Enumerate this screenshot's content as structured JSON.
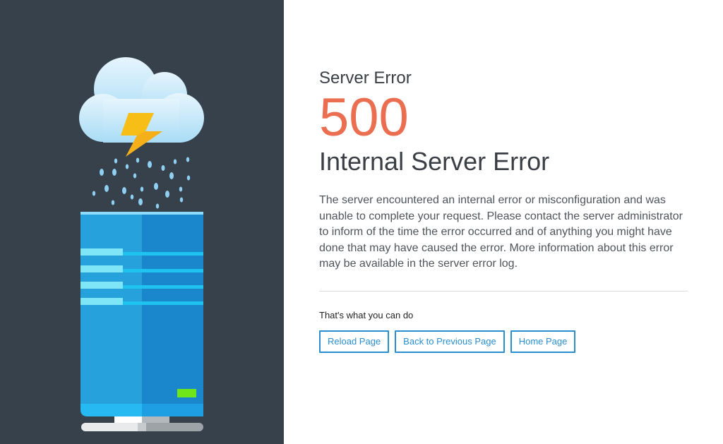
{
  "page": {
    "kicker": "Server Error",
    "code": "500",
    "title": "Internal Server Error",
    "message": "The server encountered an internal error or misconfiguration and was unable to complete your request. Please contact the server administrator to inform of the time the error occurred and of anything you might have done that may have caused the error. More information about this error may be available in the server error log.",
    "actions_label": "That's what you can do"
  },
  "buttons": {
    "reload": "Reload Page",
    "back": "Back to Previous Page",
    "home": "Home Page"
  },
  "illustration": {
    "icons": [
      "cloud-icon",
      "lightning-icon",
      "rain-icon",
      "server-icon"
    ]
  },
  "colors": {
    "panel": "#36414c",
    "accent": "#2a8fcf",
    "error_code": "#ea6e4f",
    "server_light": "#27a1dc",
    "server_dark": "#1a86cc",
    "status_led": "#6ee61a",
    "bolt": "#f7be18",
    "cloud": "#c8e9fb"
  }
}
